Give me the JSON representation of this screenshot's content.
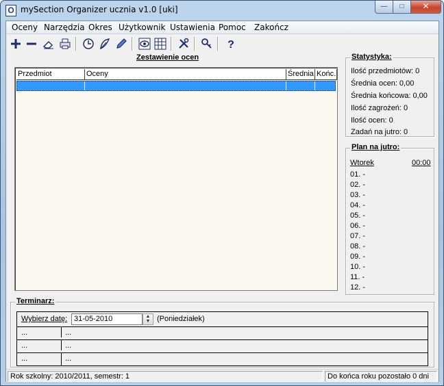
{
  "window": {
    "title": "mySection Organizer ucznia v1.0 [uki]",
    "icon_letter": "O",
    "controls": {
      "minimize": "—",
      "maximize": "□",
      "close": "✕"
    }
  },
  "menu": [
    "Oceny",
    "Narzędzia",
    "Okres",
    "Użytkownik",
    "Ustawienia",
    "Pomoc",
    "Zakończ"
  ],
  "toolbar": [
    {
      "icon": "plus-icon"
    },
    {
      "icon": "minus-icon"
    },
    {
      "icon": "eraser-icon"
    },
    {
      "icon": "printer-icon"
    },
    {
      "icon": "clock-icon"
    },
    {
      "icon": "feather-icon"
    },
    {
      "icon": "pencil-icon"
    },
    {
      "icon": "eye-icon"
    },
    {
      "icon": "table-icon"
    },
    {
      "icon": "tools-icon"
    },
    {
      "icon": "key-icon"
    },
    {
      "icon": "help-icon"
    }
  ],
  "grades": {
    "caption": "Zestawienie ocen",
    "columns": [
      "Przedmiot",
      "Oceny",
      "Średnia",
      "Końc."
    ]
  },
  "stats": {
    "title": "Statystyka:",
    "lines": [
      "Ilość przedmiotów: 0",
      "Średnia ocen: 0,00",
      "Średnia końcowa: 0,00",
      "Ilość zagrożeń: 0",
      "Ilość ocen: 0",
      "Zadań na jutro: 0"
    ]
  },
  "plan": {
    "title": "Plan na jutro:",
    "day": "Wtorek",
    "time": "00:00",
    "lessons": [
      "01. -",
      "02. -",
      "03. -",
      "04. -",
      "05. -",
      "06. -",
      "07. -",
      "08. -",
      "09. -",
      "10. -",
      "11. -",
      "12. -"
    ]
  },
  "schedule": {
    "title": "Terminarz:",
    "date_label": "Wybierz datę:",
    "date_value": "31-05-2010",
    "weekday": "(Poniedziałek)",
    "rows": [
      {
        "a": "...",
        "b": "..."
      },
      {
        "a": "...",
        "b": "..."
      },
      {
        "a": "...",
        "b": "..."
      }
    ]
  },
  "status": {
    "left": "Rok szkolny: 2010/2011, semestr: 1",
    "right": "Do końca roku pozostało 0 dni"
  }
}
